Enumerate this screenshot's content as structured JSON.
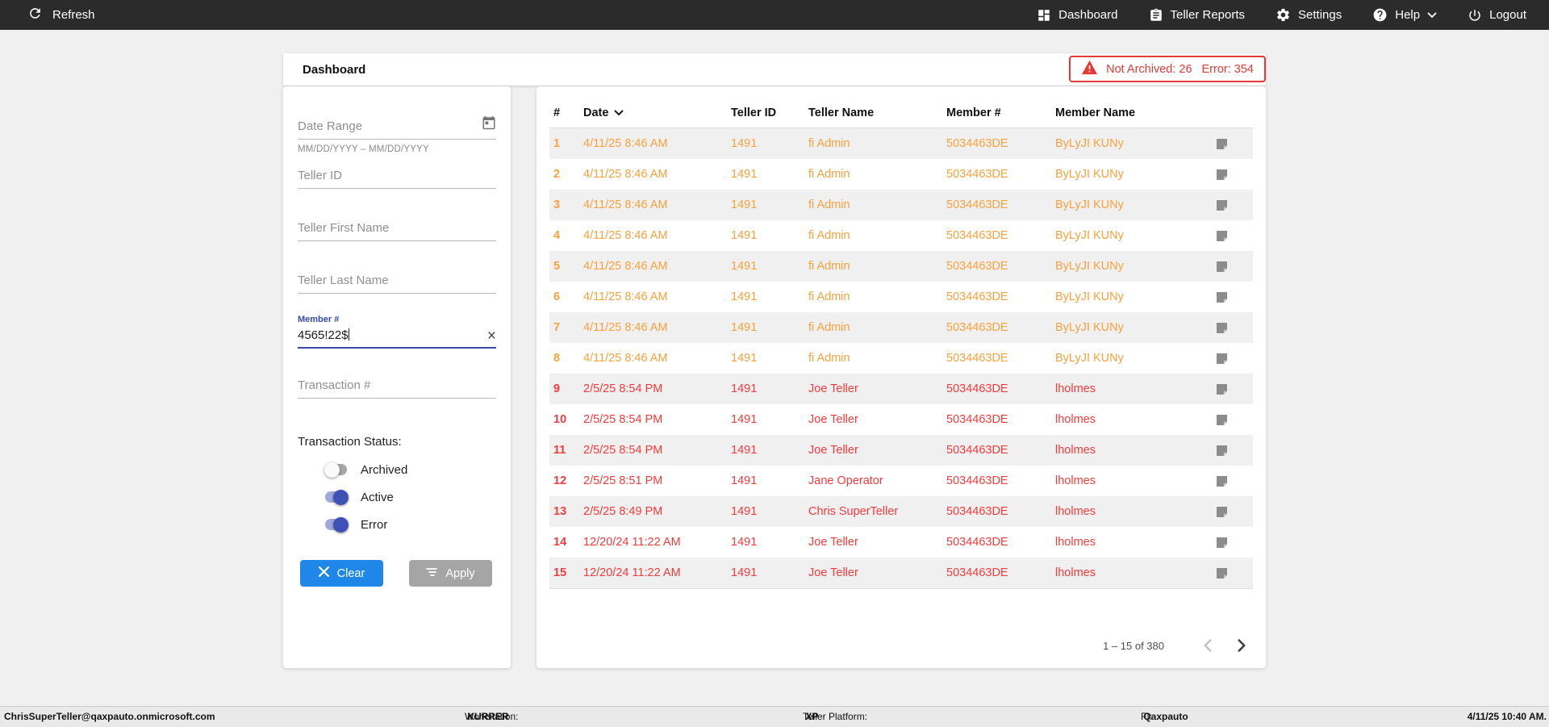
{
  "navbar": {
    "refresh_label": "Refresh",
    "items": [
      {
        "label": "Dashboard",
        "icon": "dashboard-icon"
      },
      {
        "label": "Teller Reports",
        "icon": "clipboard-icon"
      },
      {
        "label": "Settings",
        "icon": "gear-icon"
      },
      {
        "label": "Help",
        "icon": "help-icon"
      },
      {
        "label": "Logout",
        "icon": "power-icon"
      }
    ]
  },
  "header": {
    "title": "Dashboard",
    "alert": {
      "not_archived": "Not Archived: 26",
      "error": "Error: 354"
    }
  },
  "filters": {
    "date_range": {
      "placeholder": "Date Range",
      "hint": "MM/DD/YYYY – MM/DD/YYYY"
    },
    "teller_id": {
      "placeholder": "Teller ID"
    },
    "teller_first_name": {
      "placeholder": "Teller First Name"
    },
    "teller_last_name": {
      "placeholder": "Teller Last Name"
    },
    "member_number": {
      "label": "Member #",
      "value": "4565!22$"
    },
    "transaction_number": {
      "placeholder": "Transaction #"
    },
    "status": {
      "label": "Transaction Status:",
      "toggles": [
        {
          "label": "Archived",
          "on": false
        },
        {
          "label": "Active",
          "on": true
        },
        {
          "label": "Error",
          "on": true
        }
      ]
    },
    "clear_label": "Clear",
    "apply_label": "Apply"
  },
  "table": {
    "columns": [
      "#",
      "Date",
      "Teller ID",
      "Teller Name",
      "Member #",
      "Member Name"
    ],
    "sorted_column": "Date",
    "sort_direction": "desc",
    "rows": [
      {
        "num": "1",
        "date": "4/11/25 8:46 AM",
        "teller_id": "1491",
        "teller_name": "fi Admin",
        "member_number": "5034463DE",
        "member_name": "ByLyJI KUNy",
        "status": "not-archived"
      },
      {
        "num": "2",
        "date": "4/11/25 8:46 AM",
        "teller_id": "1491",
        "teller_name": "fi Admin",
        "member_number": "5034463DE",
        "member_name": "ByLyJI KUNy",
        "status": "not-archived"
      },
      {
        "num": "3",
        "date": "4/11/25 8:46 AM",
        "teller_id": "1491",
        "teller_name": "fi Admin",
        "member_number": "5034463DE",
        "member_name": "ByLyJI KUNy",
        "status": "not-archived"
      },
      {
        "num": "4",
        "date": "4/11/25 8:46 AM",
        "teller_id": "1491",
        "teller_name": "fi Admin",
        "member_number": "5034463DE",
        "member_name": "ByLyJI KUNy",
        "status": "not-archived"
      },
      {
        "num": "5",
        "date": "4/11/25 8:46 AM",
        "teller_id": "1491",
        "teller_name": "fi Admin",
        "member_number": "5034463DE",
        "member_name": "ByLyJI KUNy",
        "status": "not-archived"
      },
      {
        "num": "6",
        "date": "4/11/25 8:46 AM",
        "teller_id": "1491",
        "teller_name": "fi Admin",
        "member_number": "5034463DE",
        "member_name": "ByLyJI KUNy",
        "status": "not-archived"
      },
      {
        "num": "7",
        "date": "4/11/25 8:46 AM",
        "teller_id": "1491",
        "teller_name": "fi Admin",
        "member_number": "5034463DE",
        "member_name": "ByLyJI KUNy",
        "status": "not-archived"
      },
      {
        "num": "8",
        "date": "4/11/25 8:46 AM",
        "teller_id": "1491",
        "teller_name": "fi Admin",
        "member_number": "5034463DE",
        "member_name": "ByLyJI KUNy",
        "status": "not-archived"
      },
      {
        "num": "9",
        "date": "2/5/25 8:54 PM",
        "teller_id": "1491",
        "teller_name": "Joe Teller",
        "member_number": "5034463DE",
        "member_name": "lholmes",
        "status": "error"
      },
      {
        "num": "10",
        "date": "2/5/25 8:54 PM",
        "teller_id": "1491",
        "teller_name": "Joe Teller",
        "member_number": "5034463DE",
        "member_name": "lholmes",
        "status": "error"
      },
      {
        "num": "11",
        "date": "2/5/25 8:54 PM",
        "teller_id": "1491",
        "teller_name": "Joe Teller",
        "member_number": "5034463DE",
        "member_name": "lholmes",
        "status": "error"
      },
      {
        "num": "12",
        "date": "2/5/25 8:51 PM",
        "teller_id": "1491",
        "teller_name": "Jane Operator",
        "member_number": "5034463DE",
        "member_name": "lholmes",
        "status": "error"
      },
      {
        "num": "13",
        "date": "2/5/25 8:49 PM",
        "teller_id": "1491",
        "teller_name": "Chris SuperTeller",
        "member_number": "5034463DE",
        "member_name": "lholmes",
        "status": "error"
      },
      {
        "num": "14",
        "date": "12/20/24 11:22 AM",
        "teller_id": "1491",
        "teller_name": "Joe Teller",
        "member_number": "5034463DE",
        "member_name": "lholmes",
        "status": "error"
      },
      {
        "num": "15",
        "date": "12/20/24 11:22 AM",
        "teller_id": "1491",
        "teller_name": "Joe Teller",
        "member_number": "5034463DE",
        "member_name": "lholmes",
        "status": "error"
      }
    ],
    "pagination": {
      "label": "1 – 15 of 380"
    }
  },
  "status_bar": {
    "user": "ChrisSuperTeller@qaxpauto.onmicrosoft.com",
    "workstation_label": "Workstation:",
    "workstation": "KURRER",
    "platform_label": "Teller Platform:",
    "platform": "XP",
    "fi_label": "FI:",
    "fi": "Qaxpauto",
    "datetime": "4/11/25 10:40 AM."
  },
  "colors": {
    "navbar_bg": "#2b2b2b",
    "alert_red": "#e53935",
    "row_not_archived_orange": "#f9a13c",
    "row_error_red": "#f43b3b",
    "accent_indigo": "#3949ab",
    "toggle_on_knob": "#3f51b5",
    "toggle_on_track": "#9fa8da",
    "clear_button_blue": "#1f87e8",
    "apply_button_gray": "#a5a5a5"
  }
}
